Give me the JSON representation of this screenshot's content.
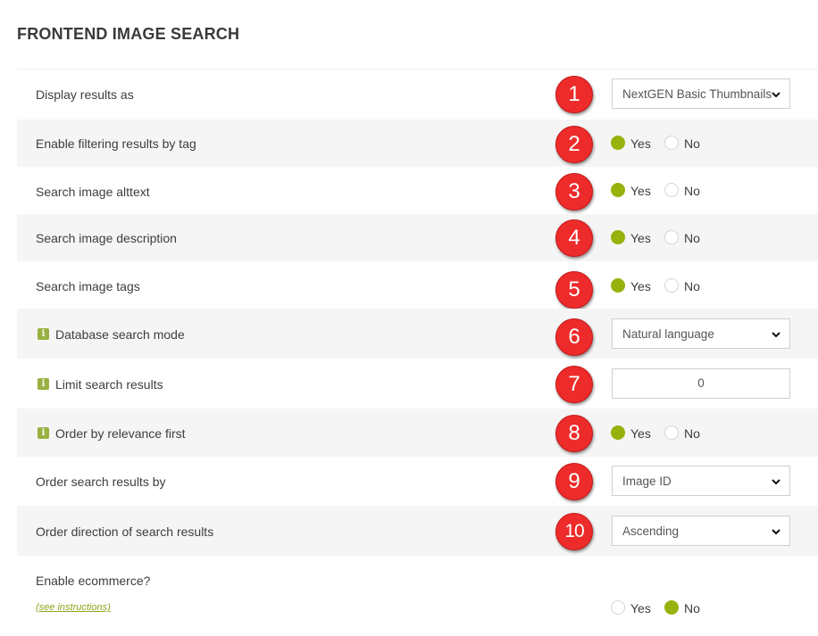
{
  "page_title": "FRONTEND IMAGE SEARCH",
  "accent_color": "#97b20c",
  "badge_color": "#ee2b2b",
  "rows": [
    {
      "label": "Display results as",
      "badge": "1",
      "select_value": "NextGEN Basic Thumbnails"
    },
    {
      "label": "Enable filtering results by tag",
      "badge": "2",
      "yes": "Yes",
      "no": "No",
      "selected": "yes"
    },
    {
      "label": "Search image alttext",
      "badge": "3",
      "yes": "Yes",
      "no": "No",
      "selected": "yes"
    },
    {
      "label": "Search image description",
      "badge": "4",
      "yes": "Yes",
      "no": "No",
      "selected": "yes"
    },
    {
      "label": "Search image tags",
      "badge": "5",
      "yes": "Yes",
      "no": "No",
      "selected": "yes"
    },
    {
      "label": "Database search mode",
      "badge": "6",
      "select_value": "Natural language",
      "info_icon": "info-icon"
    },
    {
      "label": "Limit search results",
      "badge": "7",
      "input_value": "0",
      "info_icon": "info-icon"
    },
    {
      "label": "Order by relevance first",
      "badge": "8",
      "yes": "Yes",
      "no": "No",
      "selected": "yes",
      "info_icon": "info-icon"
    },
    {
      "label": "Order search results by",
      "badge": "9",
      "select_value": "Image ID"
    },
    {
      "label": "Order direction of search results",
      "badge": "10",
      "select_value": "Ascending"
    },
    {
      "label": "Enable ecommerce?",
      "link": "(see instructions)",
      "yes": "Yes",
      "no": "No",
      "selected": "no"
    }
  ]
}
